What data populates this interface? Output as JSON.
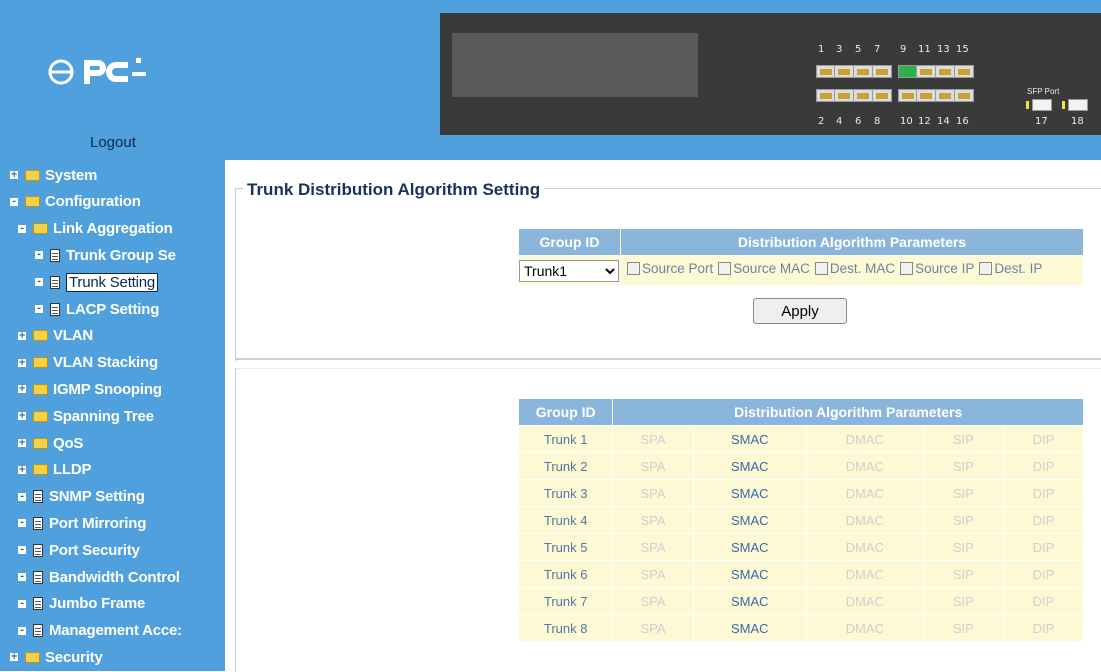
{
  "header": {
    "logout_label": "Logout",
    "logo_text": "PCI",
    "port_numbers_top": [
      "1",
      "3",
      "5",
      "7",
      "9",
      "11",
      "13",
      "15"
    ],
    "port_numbers_bottom": [
      "2",
      "4",
      "6",
      "8",
      "10",
      "12",
      "14",
      "16"
    ],
    "sfp_label": "SFP Port",
    "sfp_numbers": [
      "17",
      "18"
    ]
  },
  "sidebar": {
    "items": [
      {
        "label": "System",
        "level": 0,
        "toggle": "+",
        "icon": "folder"
      },
      {
        "label": "Configuration",
        "level": 0,
        "toggle": "-",
        "icon": "folder-open"
      },
      {
        "label": "Link Aggregation",
        "level": 1,
        "toggle": "-",
        "icon": "folder-open"
      },
      {
        "label": "Trunk Group Se",
        "level": 2,
        "toggle": "-",
        "icon": "doc"
      },
      {
        "label": "Trunk Setting",
        "level": 2,
        "toggle": "-",
        "icon": "doc",
        "active": true
      },
      {
        "label": "LACP Setting",
        "level": 2,
        "toggle": "-",
        "icon": "doc"
      },
      {
        "label": "VLAN",
        "level": 1,
        "toggle": "+",
        "icon": "folder"
      },
      {
        "label": "VLAN Stacking",
        "level": 1,
        "toggle": "+",
        "icon": "folder"
      },
      {
        "label": "IGMP Snooping",
        "level": 1,
        "toggle": "+",
        "icon": "folder"
      },
      {
        "label": "Spanning Tree",
        "level": 1,
        "toggle": "+",
        "icon": "folder"
      },
      {
        "label": "QoS",
        "level": 1,
        "toggle": "+",
        "icon": "folder"
      },
      {
        "label": "LLDP",
        "level": 1,
        "toggle": "+",
        "icon": "folder"
      },
      {
        "label": "SNMP Setting",
        "level": 1,
        "toggle": "-",
        "icon": "doc"
      },
      {
        "label": "Port Mirroring",
        "level": 1,
        "toggle": "-",
        "icon": "doc"
      },
      {
        "label": "Port Security",
        "level": 1,
        "toggle": "-",
        "icon": "doc"
      },
      {
        "label": "Bandwidth Control",
        "level": 1,
        "toggle": "-",
        "icon": "doc"
      },
      {
        "label": "Jumbo Frame",
        "level": 1,
        "toggle": "-",
        "icon": "doc"
      },
      {
        "label": "Management Acce:",
        "level": 1,
        "toggle": "-",
        "icon": "doc"
      },
      {
        "label": "Security",
        "level": 0,
        "toggle": "+",
        "icon": "folder"
      }
    ]
  },
  "main": {
    "title": "Trunk Distribution Algorithm Setting",
    "form": {
      "col_group": "Group ID",
      "col_params": "Distribution Algorithm Parameters",
      "selected_group": "Trunk1",
      "checkboxes": [
        "Source Port",
        "Source MAC",
        "Dest. MAC",
        "Source IP",
        "Dest. IP"
      ],
      "apply_label": "Apply"
    },
    "status": {
      "col_group": "Group ID",
      "col_params": "Distribution Algorithm Parameters",
      "rows": [
        {
          "group": "Trunk 1",
          "spa": "SPA",
          "smac": "SMAC",
          "dmac": "DMAC",
          "sip": "SIP",
          "dip": "DIP"
        },
        {
          "group": "Trunk 2",
          "spa": "SPA",
          "smac": "SMAC",
          "dmac": "DMAC",
          "sip": "SIP",
          "dip": "DIP"
        },
        {
          "group": "Trunk 3",
          "spa": "SPA",
          "smac": "SMAC",
          "dmac": "DMAC",
          "sip": "SIP",
          "dip": "DIP"
        },
        {
          "group": "Trunk 4",
          "spa": "SPA",
          "smac": "SMAC",
          "dmac": "DMAC",
          "sip": "SIP",
          "dip": "DIP"
        },
        {
          "group": "Trunk 5",
          "spa": "SPA",
          "smac": "SMAC",
          "dmac": "DMAC",
          "sip": "SIP",
          "dip": "DIP"
        },
        {
          "group": "Trunk 6",
          "spa": "SPA",
          "smac": "SMAC",
          "dmac": "DMAC",
          "sip": "SIP",
          "dip": "DIP"
        },
        {
          "group": "Trunk 7",
          "spa": "SPA",
          "smac": "SMAC",
          "dmac": "DMAC",
          "sip": "SIP",
          "dip": "DIP"
        },
        {
          "group": "Trunk 8",
          "spa": "SPA",
          "smac": "SMAC",
          "dmac": "DMAC",
          "sip": "SIP",
          "dip": "DIP"
        }
      ]
    }
  },
  "colors": {
    "brand_blue": "#4fa0dd",
    "table_header": "#8ab6dc",
    "row_bg": "#fdf9d4",
    "link_active": "#3a6aa5",
    "disabled_text": "#cfcfcf"
  }
}
